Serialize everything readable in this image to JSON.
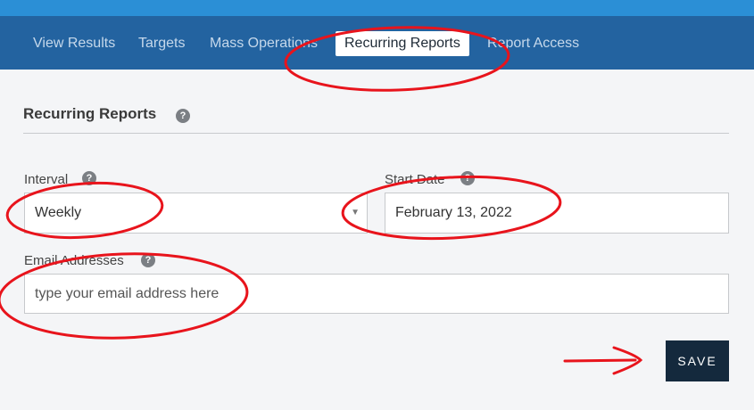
{
  "nav": {
    "items": [
      {
        "label": "View Results",
        "active": false
      },
      {
        "label": "Targets",
        "active": false
      },
      {
        "label": "Mass Operations",
        "active": false
      },
      {
        "label": "Recurring Reports",
        "active": true
      },
      {
        "label": "Report Access",
        "active": false
      }
    ]
  },
  "section": {
    "title": "Recurring Reports"
  },
  "interval": {
    "label": "Interval",
    "value": "Weekly"
  },
  "start_date": {
    "label": "Start Date",
    "value": "February 13, 2022"
  },
  "email": {
    "label": "Email Addresses",
    "placeholder": "type your email address here"
  },
  "save": {
    "label": "SAVE"
  },
  "help_glyph": "?",
  "select_arrow": "▼",
  "colors": {
    "top_strip": "#2b8fd6",
    "navbar": "#2363a0",
    "save_button": "#14293d",
    "annotation": "#e8141c"
  }
}
